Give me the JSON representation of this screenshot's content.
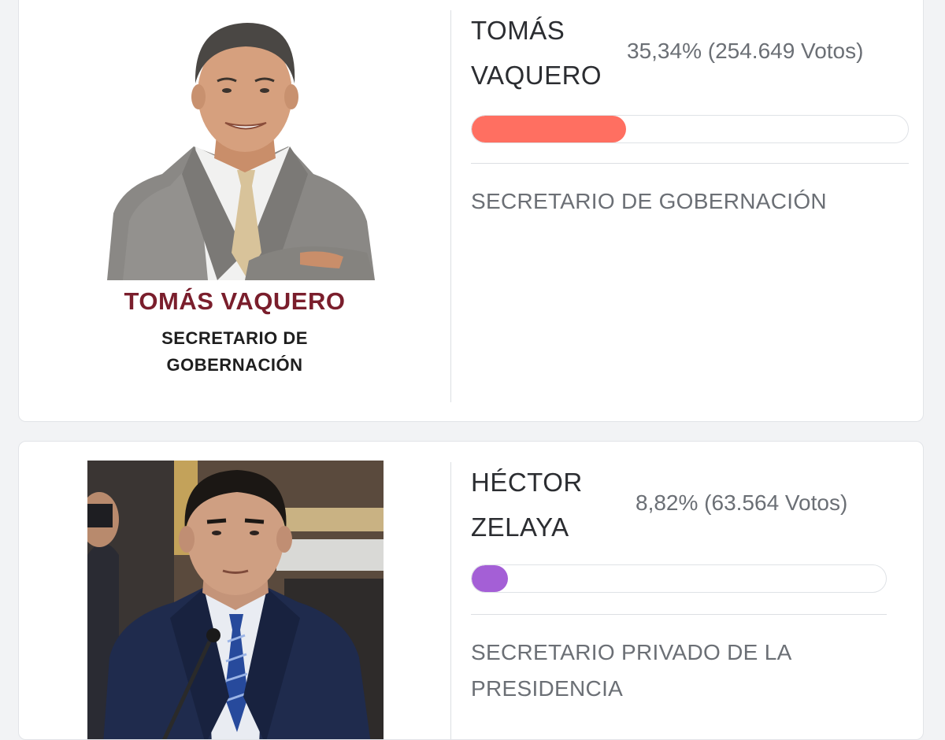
{
  "candidates": [
    {
      "name_line1": "TOMÁS",
      "name_line2": "VAQUERO",
      "percent_text": "35,34% (254.649 Votos)",
      "percent": 35.34,
      "votes": 254649,
      "bar_color": "#ff6f61",
      "role": "SECRETARIO DE GOBERNACIÓN",
      "photo_caption_name": "TOMÁS VAQUERO",
      "photo_caption_role_line1": "SECRETARIO DE",
      "photo_caption_role_line2": "GOBERNACIÓN"
    },
    {
      "name_line1": "HÉCTOR",
      "name_line2": "ZELAYA",
      "percent_text": "8,82% (63.564 Votos)",
      "percent": 8.82,
      "votes": 63564,
      "bar_color": "#a45fd6",
      "role_line1": "SECRETARIO PRIVADO DE LA",
      "role_line2": "PRESIDENCIA"
    }
  ]
}
